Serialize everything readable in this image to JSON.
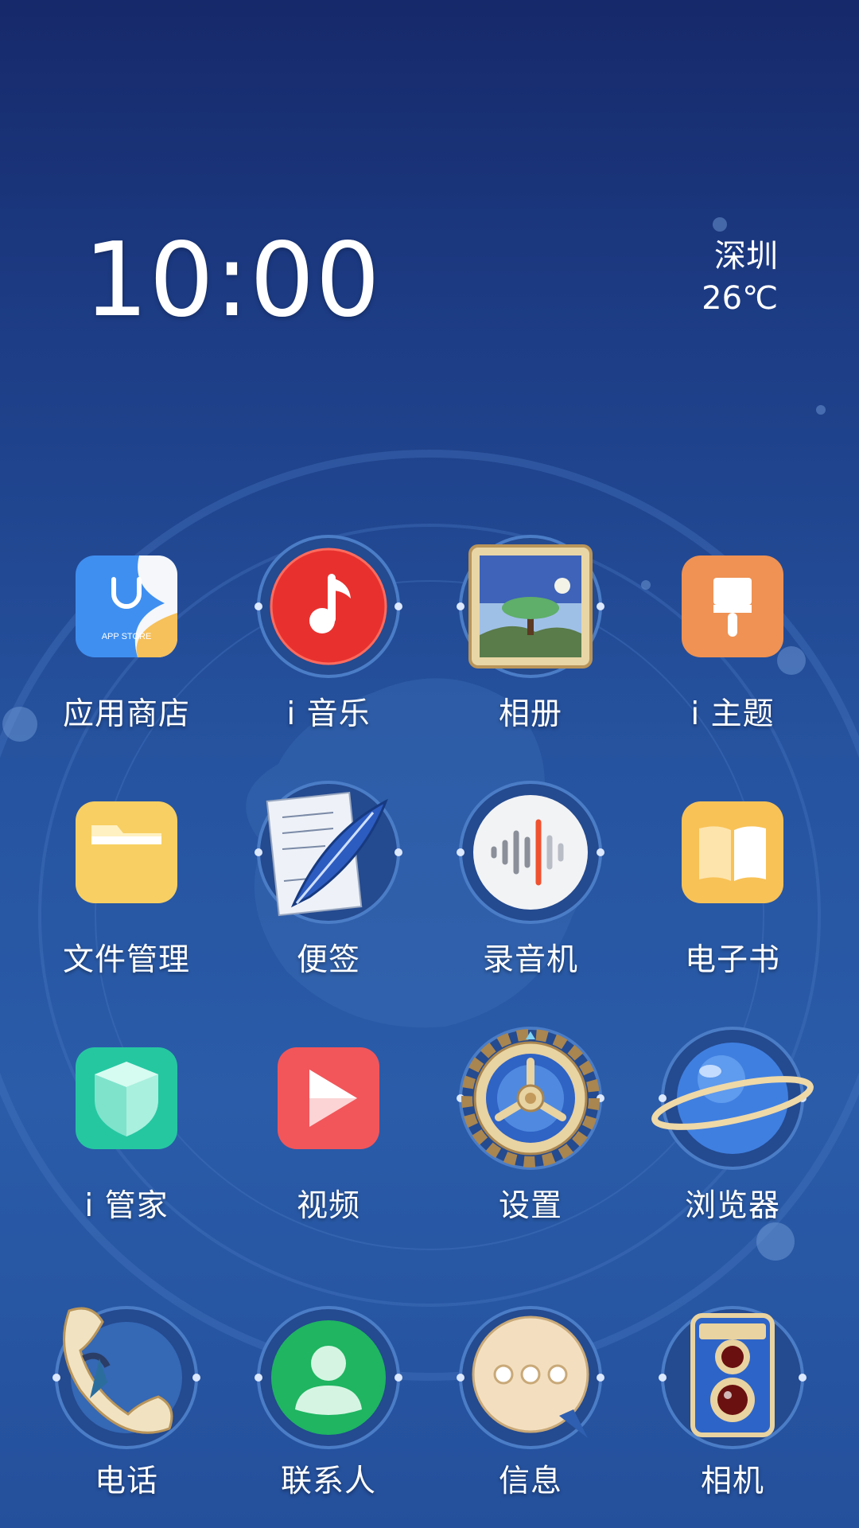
{
  "status": {
    "time": "10:00",
    "city": "深圳",
    "temperature": "26℃"
  },
  "home_grid": {
    "rows": [
      [
        {
          "label": "应用商店",
          "icon": "app-store-icon"
        },
        {
          "label": "i 音乐",
          "icon": "music-icon"
        },
        {
          "label": "相册",
          "icon": "gallery-icon"
        },
        {
          "label": "i 主题",
          "icon": "theme-brush-icon"
        }
      ],
      [
        {
          "label": "文件管理",
          "icon": "folder-icon"
        },
        {
          "label": "便签",
          "icon": "notes-quill-icon"
        },
        {
          "label": "录音机",
          "icon": "recorder-icon"
        },
        {
          "label": "电子书",
          "icon": "ebook-icon"
        }
      ],
      [
        {
          "label": "i 管家",
          "icon": "shield-cube-icon"
        },
        {
          "label": "视频",
          "icon": "video-play-icon"
        },
        {
          "label": "设置",
          "icon": "settings-gear-icon"
        },
        {
          "label": "浏览器",
          "icon": "browser-planet-icon"
        }
      ]
    ]
  },
  "dock": {
    "items": [
      {
        "label": "电话",
        "icon": "phone-icon"
      },
      {
        "label": "联系人",
        "icon": "contacts-icon"
      },
      {
        "label": "信息",
        "icon": "messages-icon"
      },
      {
        "label": "相机",
        "icon": "camera-icon"
      }
    ]
  },
  "app_store_icon_text": "APP STORE",
  "colors": {
    "background_top": "#16296a",
    "background_mid": "#26539f",
    "label_text": "#ffffff"
  }
}
